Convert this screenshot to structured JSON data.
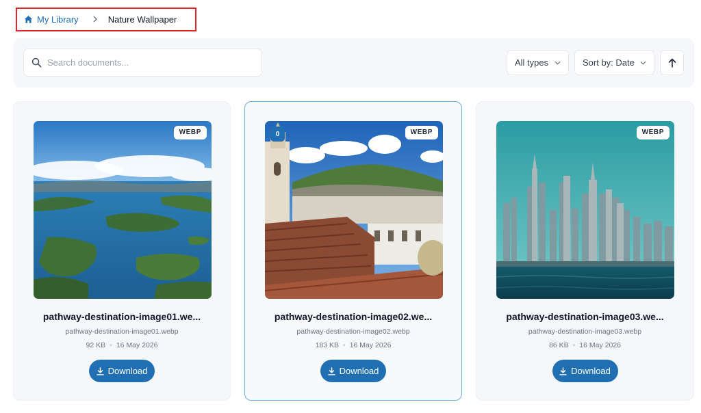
{
  "breadcrumb": {
    "home_label": "My Library",
    "current_label": "Nature Wallpaper"
  },
  "toolbar": {
    "search_placeholder": "Search documents...",
    "type_filter_value": "All types",
    "sort_value": "Sort by: Date",
    "sort_direction_icon": "arrow-up-icon"
  },
  "colors": {
    "accent": "#1f6fb2",
    "highlight_border": "#e0262b",
    "selected_card_border": "#6fb0d8"
  },
  "documents": [
    {
      "title": "pathway-destination-image01.we...",
      "filename": "pathway-destination-image01.webp",
      "size": "92 KB",
      "date": "16 May 2026",
      "type_badge": "WEBP",
      "download_label": "Download",
      "selected": false
    },
    {
      "title": "pathway-destination-image02.we...",
      "filename": "pathway-destination-image02.webp",
      "size": "183 KB",
      "date": "16 May 2026",
      "type_badge": "WEBP",
      "download_label": "Download",
      "selected": true,
      "selection_index": "0"
    },
    {
      "title": "pathway-destination-image03.we...",
      "filename": "pathway-destination-image03.webp",
      "size": "86 KB",
      "date": "16 May 2026",
      "type_badge": "WEBP",
      "download_label": "Download",
      "selected": false
    }
  ]
}
